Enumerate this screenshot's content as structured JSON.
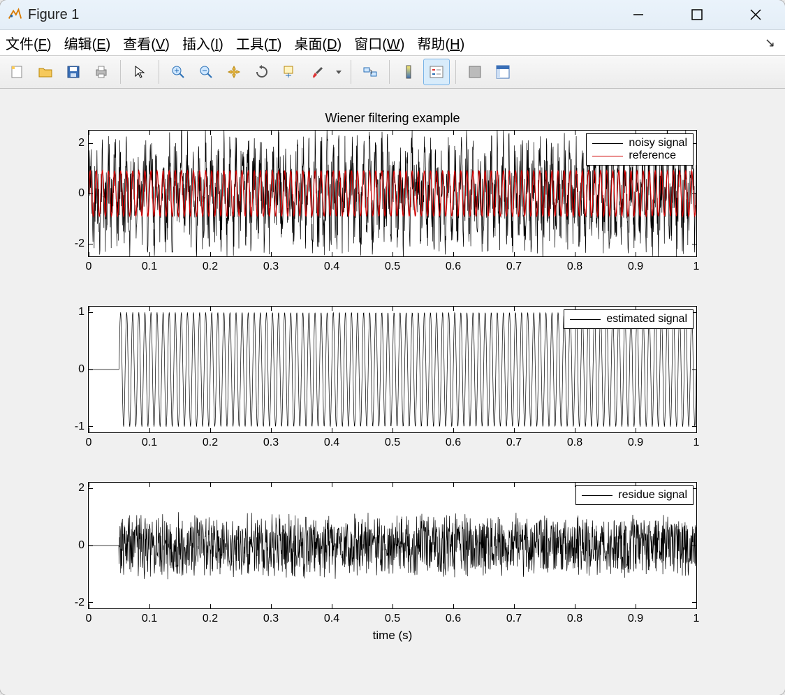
{
  "window": {
    "title": "Figure 1"
  },
  "menu": {
    "file": {
      "text": "文件",
      "key": "F"
    },
    "edit": {
      "text": "编辑",
      "key": "E"
    },
    "view": {
      "text": "查看",
      "key": "V"
    },
    "insert": {
      "text": "插入",
      "key": "I"
    },
    "tools": {
      "text": "工具",
      "key": "T"
    },
    "desktop": {
      "text": "桌面",
      "key": "D"
    },
    "window_": {
      "text": "窗口",
      "key": "W"
    },
    "help": {
      "text": "帮助",
      "key": "H"
    }
  },
  "chart_data": [
    {
      "type": "line",
      "title": "Wiener filtering example",
      "x_range": [
        0,
        1
      ],
      "x_ticks": [
        0,
        0.1,
        0.2,
        0.3,
        0.4,
        0.5,
        0.6,
        0.7,
        0.8,
        0.9,
        1
      ],
      "y_ticks": [
        -2,
        0,
        2
      ],
      "ylim": [
        -2.5,
        2.5
      ],
      "series": [
        {
          "name": "noisy signal",
          "color": "#000000",
          "kind": "noisy-sine",
          "amp": 2.0,
          "freq": 100,
          "noise": 0.5
        },
        {
          "name": "reference",
          "color": "#d00000",
          "kind": "sine",
          "amp": 0.9,
          "freq": 100
        }
      ]
    },
    {
      "type": "line",
      "x_range": [
        0,
        1
      ],
      "x_ticks": [
        0,
        0.1,
        0.2,
        0.3,
        0.4,
        0.5,
        0.6,
        0.7,
        0.8,
        0.9,
        1
      ],
      "y_ticks": [
        -1,
        0,
        1
      ],
      "ylim": [
        -1.1,
        1.1
      ],
      "transient_until": 0.05,
      "series": [
        {
          "name": "estimated signal",
          "color": "#000000",
          "kind": "sine",
          "amp": 1.0,
          "freq": 100
        }
      ]
    },
    {
      "type": "line",
      "x_range": [
        0,
        1
      ],
      "x_ticks": [
        0,
        0.1,
        0.2,
        0.3,
        0.4,
        0.5,
        0.6,
        0.7,
        0.8,
        0.9,
        1
      ],
      "y_ticks": [
        -2,
        0,
        2
      ],
      "ylim": [
        -2.2,
        2.2
      ],
      "transient_until": 0.05,
      "xlabel": "time (s)",
      "series": [
        {
          "name": "residue signal",
          "color": "#000000",
          "kind": "noise",
          "amp": 1.0
        }
      ]
    }
  ]
}
